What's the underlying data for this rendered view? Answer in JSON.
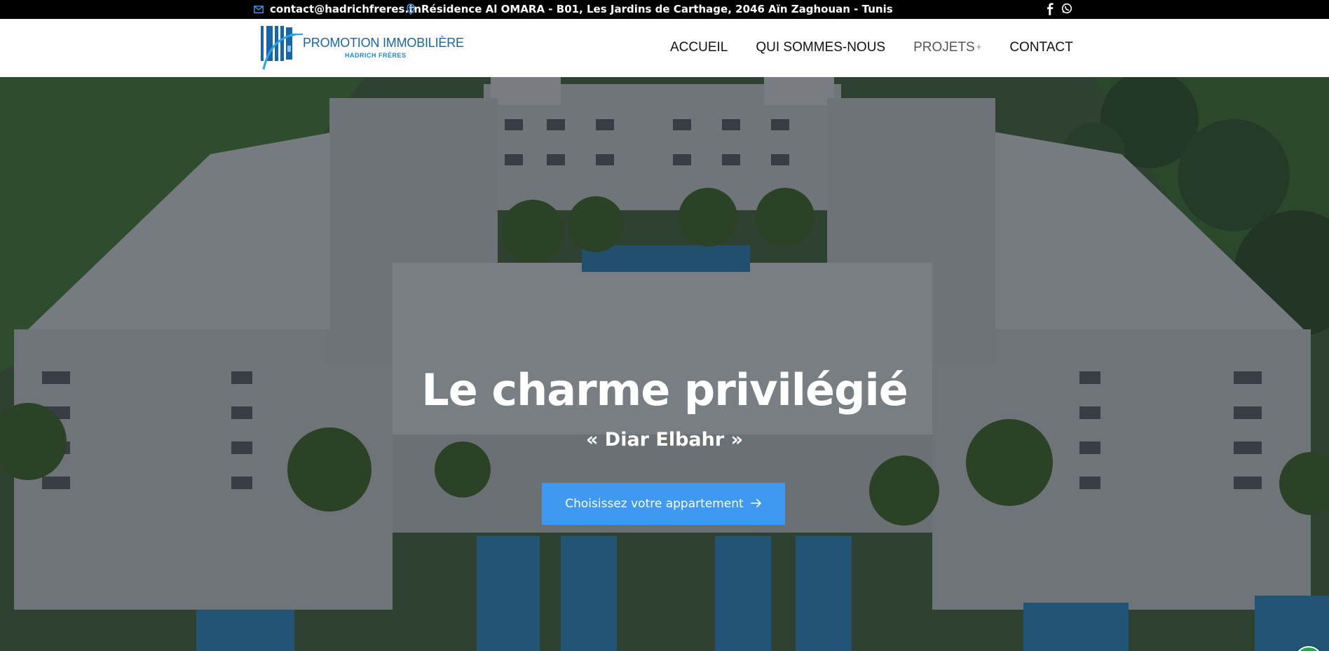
{
  "topbar": {
    "email": "contact@hadrichfreres.tn",
    "address": "Résidence Al OMARA - B01, Les Jardins de Carthage, 2046 Aïn Zaghouan - Tunis",
    "icons": [
      "mail-icon",
      "map-pin-icon",
      "facebook-icon",
      "whatsapp-icon"
    ]
  },
  "logo": {
    "title": "PROMOTION IMMOBILIÈRE",
    "subtitle": "HADRICH FRÈRES"
  },
  "nav": {
    "items": [
      {
        "label": "ACCUEIL"
      },
      {
        "label": "QUI SOMMES-NOUS"
      },
      {
        "label": "PROJETS",
        "suffix": "+"
      },
      {
        "label": "CONTACT"
      }
    ]
  },
  "hero": {
    "title": "Le charme privilégié",
    "subtitle": "« Diar Elbahr »",
    "cta_label": "Choisissez votre appartement"
  },
  "colors": {
    "topbar_bg": "#000000",
    "brand_blue": "#1565a8",
    "cta_blue": "#3f99f0",
    "whatsapp_green": "#25a545"
  }
}
